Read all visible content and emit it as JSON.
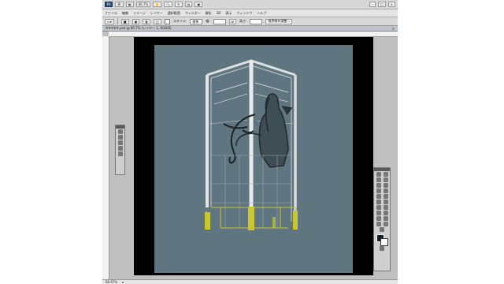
{
  "app": {
    "title_buttons": [
      "Ps",
      "Br"
    ],
    "zoom": "66.7%",
    "window_controls": [
      "–",
      "□",
      "×"
    ]
  },
  "menu": {
    "items": [
      "ファイル",
      "編集",
      "イメージ",
      "レイヤー",
      "選択範囲",
      "フィルター",
      "解析",
      "3D",
      "表示",
      "ウィンドウ",
      "ヘルプ"
    ]
  },
  "options": {
    "style_label": "スタイル:",
    "style_value": "標準",
    "width_label": "幅:",
    "height_label": "高さ:",
    "refine_button": "境界線を調整..."
  },
  "document": {
    "tab_title": "※※※※※.psd @ 66.7% (レイヤー 1, RGB/8)"
  },
  "status": {
    "zoom": "66.67%"
  },
  "colors": {
    "canvas": "#5f7580",
    "pasteboard": "#000000",
    "workspace": "#c0c0c0",
    "accent_yellow": "#c8c82e"
  },
  "icons": {
    "toolbox": [
      "move-tool-icon",
      "marquee-tool-icon",
      "lasso-tool-icon",
      "magic-wand-icon",
      "crop-tool-icon",
      "eyedropper-icon",
      "healing-brush-icon",
      "brush-tool-icon",
      "clone-stamp-icon",
      "history-brush-icon",
      "eraser-icon",
      "gradient-tool-icon",
      "blur-tool-icon",
      "dodge-tool-icon",
      "pen-tool-icon",
      "type-tool-icon",
      "path-selection-icon",
      "shape-tool-icon",
      "3d-rotate-icon",
      "hand-tool-icon",
      "zoom-tool-icon"
    ],
    "left_panel": [
      "move-icon",
      "brush-icon",
      "lasso-icon",
      "stamp-icon",
      "pen-icon"
    ]
  }
}
